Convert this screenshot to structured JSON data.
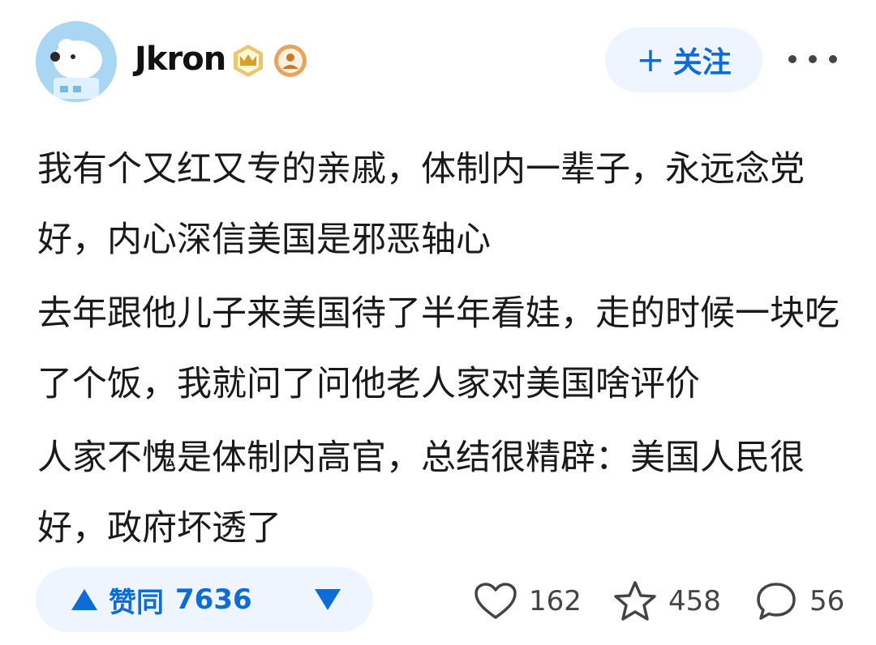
{
  "header": {
    "username": "Jkron",
    "follow_label": "关注",
    "follow_plus": "+",
    "avatar_icon": "cartoon-dog-avatar",
    "badges": [
      "crown-badge-icon",
      "person-badge-icon"
    ]
  },
  "content": {
    "paragraphs": [
      "我有个又红又专的亲戚，体制内一辈子，永远念党好，内心深信美国是邪恶轴心",
      "去年跟他儿子来美国待了半年看娃，走的时候一块吃了个饭，我就问了问他老人家对美国啥评价",
      "人家不愧是体制内高官，总结很精辟：美国人民很好，政府坏透了"
    ]
  },
  "footer": {
    "vote_label": "赞同",
    "vote_count": "7636",
    "likes": "162",
    "favorites": "458",
    "comments": "56"
  },
  "colors": {
    "accent": "#0f6bd6",
    "accent_bg": "#eef5ff"
  }
}
